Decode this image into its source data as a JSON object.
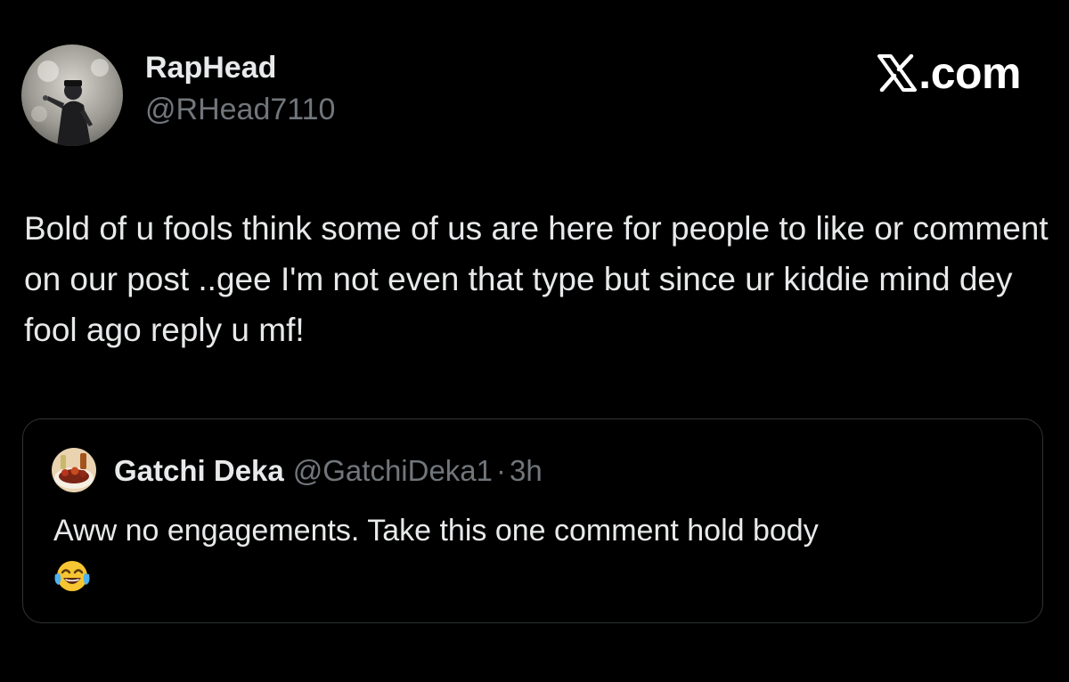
{
  "author": {
    "display_name": "RapHead",
    "handle": "@RHead7110",
    "avatar_icon": "performer-with-microphone-avatar"
  },
  "brand": {
    "label": ".com",
    "logo_icon": "x-logo-icon"
  },
  "post": {
    "text": "Bold of u fools think some of us are here for people to like or comment on our post ..gee I'm not even that type but since ur kiddie mind dey fool ago reply u mf!"
  },
  "quoted_post": {
    "display_name": "Gatchi Deka",
    "handle": "@GatchiDeka1",
    "separator": "·",
    "time": "3h",
    "text": "Aww no engagements. Take this one comment hold body",
    "emoji_icon": "face-with-tears-of-joy-icon",
    "avatar_icon": "food-plate-avatar"
  },
  "colors": {
    "background": "#000000",
    "text_primary": "#e7e9ea",
    "text_secondary": "#71767b",
    "border": "#2f3336"
  }
}
